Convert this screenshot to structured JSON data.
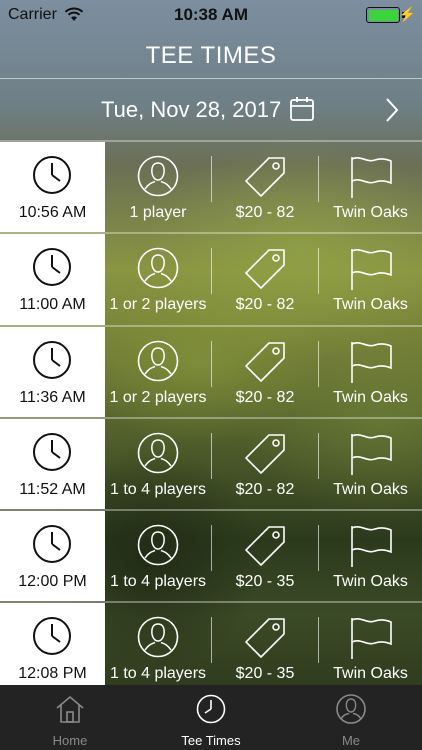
{
  "status_bar": {
    "carrier": "Carrier",
    "time": "10:38 AM",
    "battery_color": "#3cd43c"
  },
  "header": {
    "title": "TEE TIMES",
    "date": "Tue, Nov 28, 2017"
  },
  "icons": {
    "time": "clock-icon",
    "players": "person-icon",
    "price": "price-tag-icon",
    "course": "flag-icon"
  },
  "tee_times": [
    {
      "time": "10:56 AM",
      "players": "1 player",
      "price": "$20 - 82",
      "course": "Twin Oaks"
    },
    {
      "time": "11:00 AM",
      "players": "1 or 2 players",
      "price": "$20 - 82",
      "course": "Twin Oaks"
    },
    {
      "time": "11:36 AM",
      "players": "1 or 2 players",
      "price": "$20 - 82",
      "course": "Twin Oaks"
    },
    {
      "time": "11:52 AM",
      "players": "1 to 4 players",
      "price": "$20 - 82",
      "course": "Twin Oaks"
    },
    {
      "time": "12:00 PM",
      "players": "1 to 4 players",
      "price": "$20 - 35",
      "course": "Twin Oaks"
    },
    {
      "time": "12:08 PM",
      "players": "1 to 4 players",
      "price": "$20 - 35",
      "course": "Twin Oaks"
    }
  ],
  "tab_bar": {
    "active_color": "#ffffff",
    "inactive_color": "#8a8a8a",
    "items": [
      {
        "label": "Home",
        "icon": "house-icon",
        "active": false
      },
      {
        "label": "Tee Times",
        "icon": "clock-icon",
        "active": true
      },
      {
        "label": "Me",
        "icon": "person-icon",
        "active": false
      }
    ]
  }
}
